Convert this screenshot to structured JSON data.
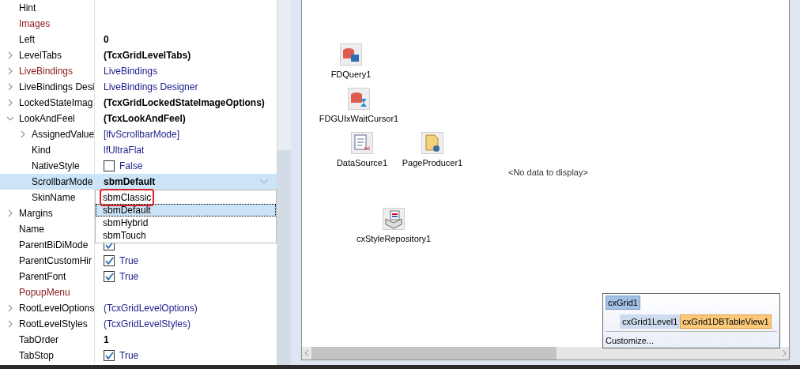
{
  "inspector": {
    "properties": [
      {
        "name": "Hint"
      },
      {
        "name": "Images",
        "reference": true
      },
      {
        "name": "Left",
        "value": "0",
        "bold": true
      },
      {
        "name": "LevelTabs",
        "expanded": false,
        "value": "(TcxGridLevelTabs)",
        "bold": true
      },
      {
        "name": "LiveBindings",
        "reference": true,
        "expanded": false,
        "value": "LiveBindings",
        "bold": false
      },
      {
        "name": "LiveBindings Desi",
        "expanded": false,
        "value": "LiveBindings Designer",
        "bold": false
      },
      {
        "name": "LockedStateImag",
        "expanded": false,
        "value": "(TcxGridLockedStateImageOptions)",
        "bold": true
      },
      {
        "name": "LookAndFeel",
        "expanded": true,
        "value": "(TcxLookAndFeel)",
        "bold": true,
        "children": [
          {
            "name": "AssignedValue",
            "expanded": false,
            "value": "[lfvScrollbarMode]",
            "bold": false
          },
          {
            "name": "Kind",
            "value": "lfUltraFlat",
            "bold": false
          },
          {
            "name": "NativeStyle",
            "value": "False",
            "bold": false,
            "checked": false
          },
          {
            "name": "ScrollbarMode",
            "selected": true,
            "value": "sbmDefault",
            "bold": true
          },
          {
            "name": "SkinName"
          }
        ]
      },
      {
        "name": "Margins",
        "expanded": false
      },
      {
        "name": "Name"
      },
      {
        "name": "ParentBiDiMode",
        "checked": true
      },
      {
        "name": "ParentCustomHir",
        "value": "True",
        "bold": false,
        "checked": true
      },
      {
        "name": "ParentFont",
        "value": "True",
        "bold": false,
        "checked": true
      },
      {
        "name": "PopupMenu",
        "reference": true
      },
      {
        "name": "RootLevelOptions",
        "expanded": false,
        "value": "(TcxGridLevelOptions)",
        "bold": false
      },
      {
        "name": "RootLevelStyles",
        "expanded": false,
        "value": "(TcxGridLevelStyles)",
        "bold": false
      },
      {
        "name": "TabOrder",
        "value": "1",
        "bold": true
      },
      {
        "name": "TabStop",
        "value": "True",
        "bold": false,
        "checked": true
      }
    ],
    "dropdown": [
      {
        "label": "sbmClassic",
        "selected": false,
        "marked": true
      },
      {
        "label": "sbmDefault",
        "selected": true,
        "marked": false
      },
      {
        "label": "sbmHybrid",
        "selected": false,
        "marked": false
      },
      {
        "label": "sbmTouch",
        "selected": false,
        "marked": false
      }
    ]
  },
  "designer": {
    "components": [
      {
        "label": "FDQuery1",
        "kind": "query"
      },
      {
        "label": "FDGUIxWaitCursor1",
        "kind": "wait"
      },
      {
        "label": "DataSource1",
        "kind": "datasource"
      },
      {
        "label": "PageProducer1",
        "kind": "producer"
      },
      {
        "label": "cxStyleRepository1",
        "kind": "styles"
      }
    ],
    "empty_text": "<No data to display>",
    "structure": {
      "grid": "cxGrid1",
      "level": "cxGrid1Level1",
      "view": "cxGrid1DBTableView1",
      "customize": "Customize..."
    }
  }
}
